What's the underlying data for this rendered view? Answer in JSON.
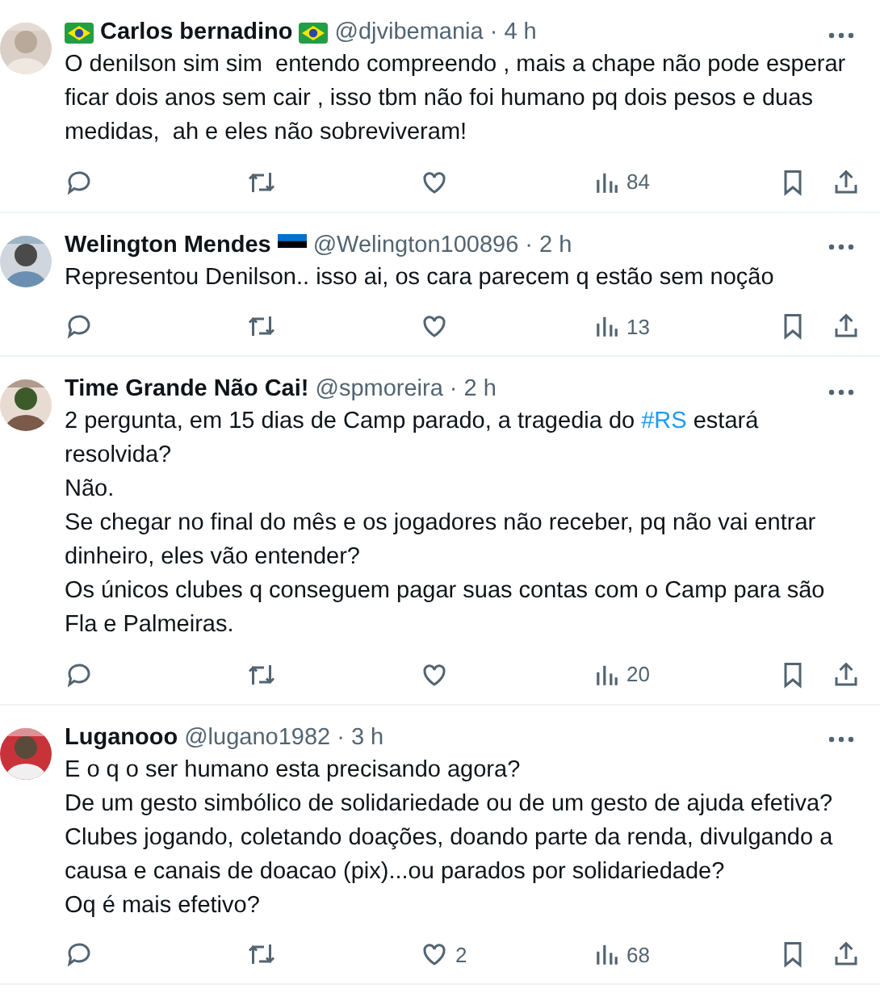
{
  "tweets": [
    {
      "name": "Carlos bernadino",
      "flag_before": {
        "kind": "diamond"
      },
      "flag_after": {
        "kind": "diamond"
      },
      "handle": "@djvibemania",
      "separator": "·",
      "time": "4 h",
      "avatar": {
        "kind": "picture"
      },
      "body": [
        [
          {
            "kind": "text",
            "text": "O denilson sim sim  entendo compreendo , mais a chape não pode esperar ficar dois anos sem cair , isso tbm não foi humano pq dois pesos e duas medidas,  ah e eles não sobreviveram!"
          }
        ]
      ],
      "views": "84"
    },
    {
      "name": "Welington Mendes",
      "flag_after": {
        "kind": "stripes"
      },
      "handle": "@Welington100896",
      "separator": "·",
      "time": "2 h",
      "avatar": {
        "kind": "picture"
      },
      "body": [
        [
          {
            "kind": "text",
            "text": "Representou Denilson.. isso ai, os cara parecem q estão sem noção"
          }
        ]
      ],
      "views": "13"
    },
    {
      "name": "Time Grande Não Cai!",
      "handle": "@spmoreira",
      "separator": "·",
      "time": "2 h",
      "avatar": {
        "kind": "picture"
      },
      "body": [
        [
          {
            "kind": "text",
            "text": "2 pergunta, em 15 dias de Camp parado, a tragedia do "
          },
          {
            "kind": "hashtag",
            "text": "#RS"
          },
          {
            "kind": "text",
            "text": " estará resolvida?"
          }
        ],
        [
          {
            "kind": "text",
            "text": "Não."
          }
        ],
        [
          {
            "kind": "text",
            "text": "Se chegar no final do mês e os jogadores não receber, pq não vai entrar dinheiro, eles vão entender?"
          }
        ],
        [
          {
            "kind": "text",
            "text": "Os únicos clubes q conseguem pagar suas contas com o Camp para são Fla e Palmeiras."
          }
        ]
      ],
      "views": "20"
    },
    {
      "name": "Luganooo",
      "handle": "@lugano1982",
      "separator": "·",
      "time": "3 h",
      "avatar": {
        "kind": "picture"
      },
      "body": [
        [
          {
            "kind": "text",
            "text": "E o q o ser humano esta precisando agora?"
          }
        ],
        [
          {
            "kind": "text",
            "text": "De um gesto simbólico de solidariedade ou de um gesto de ajuda efetiva?"
          }
        ],
        [
          {
            "kind": "text",
            "text": "Clubes jogando, coletando doações, doando parte da renda, divulgando a causa e canais de doacao (pix)...ou parados por solidariedade?"
          }
        ],
        [
          {
            "kind": "text",
            "text": "Oq é mais efetivo?"
          }
        ]
      ],
      "likes": "2",
      "views": "68"
    }
  ]
}
